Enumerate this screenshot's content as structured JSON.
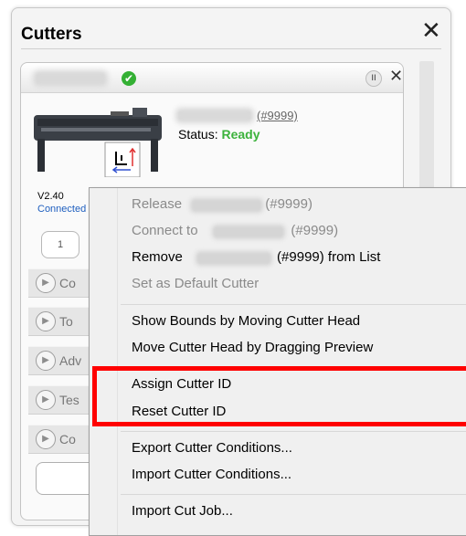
{
  "panel": {
    "title": "Cutters",
    "close_glyph": "✕"
  },
  "card": {
    "connected_glyph": "✔",
    "pause_glyph": "II",
    "close_glyph": "✕",
    "cutter_id": "(#9999)",
    "status_label": "Status:",
    "status_value": "Ready",
    "version": "V2.40",
    "connection": "Connected",
    "page_number": "1",
    "sections": [
      {
        "label": "Co"
      },
      {
        "label": "To"
      },
      {
        "label": "Adv"
      },
      {
        "label": "Tes"
      },
      {
        "label": "Co"
      }
    ]
  },
  "menu": {
    "release": {
      "prefix": "Release",
      "suffix": "(#9999)"
    },
    "connect": {
      "prefix": "Connect to",
      "suffix": "(#9999)"
    },
    "remove": {
      "prefix": "Remove",
      "suffix": "(#9999) from List"
    },
    "set_default": "Set as Default Cutter",
    "show_bounds": "Show Bounds by Moving Cutter Head",
    "move_head": "Move Cutter Head by Dragging Preview",
    "assign_id": "Assign Cutter ID",
    "reset_id": "Reset Cutter ID",
    "export_conditions": "Export Cutter Conditions...",
    "import_conditions": "Import Cutter Conditions...",
    "import_job": "Import Cut Job..."
  },
  "colors": {
    "status_ready": "#3cb23c",
    "highlight": "#ff0000",
    "link": "#1f5fbf"
  }
}
